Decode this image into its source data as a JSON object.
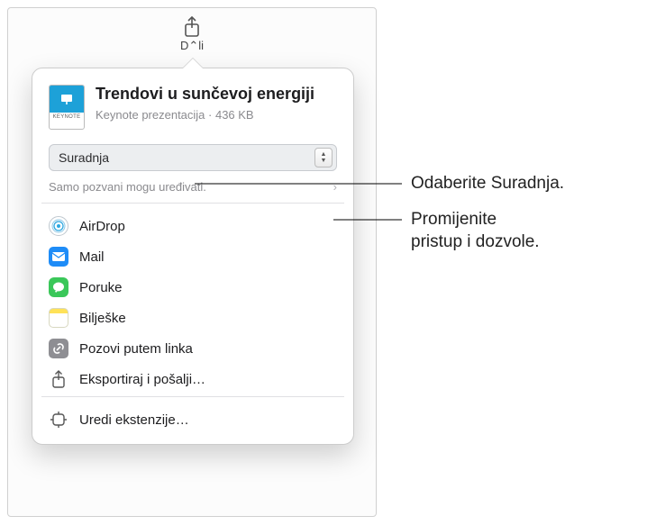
{
  "toolbar": {
    "partial_label": "D⌃li"
  },
  "document": {
    "thumb_app": "KEYNOTE",
    "title": "Trendovi u sunčevoj energiji",
    "meta": "Keynote prezentacija · 436 KB"
  },
  "mode_select": {
    "value": "Suradnja"
  },
  "access": {
    "summary": "Samo pozvani mogu uređivati."
  },
  "share_options": [
    {
      "id": "airdrop",
      "label": "AirDrop"
    },
    {
      "id": "mail",
      "label": "Mail"
    },
    {
      "id": "poruke",
      "label": "Poruke"
    },
    {
      "id": "biljeske",
      "label": "Bilješke"
    },
    {
      "id": "link",
      "label": "Pozovi putem linka"
    },
    {
      "id": "export",
      "label": "Eksportiraj i pošalji…"
    }
  ],
  "edit_ext": {
    "label": "Uredi ekstenzije…"
  },
  "callouts": {
    "a": "Odaberite Suradnja.",
    "b": "Promijenite\npristup i dozvole."
  }
}
